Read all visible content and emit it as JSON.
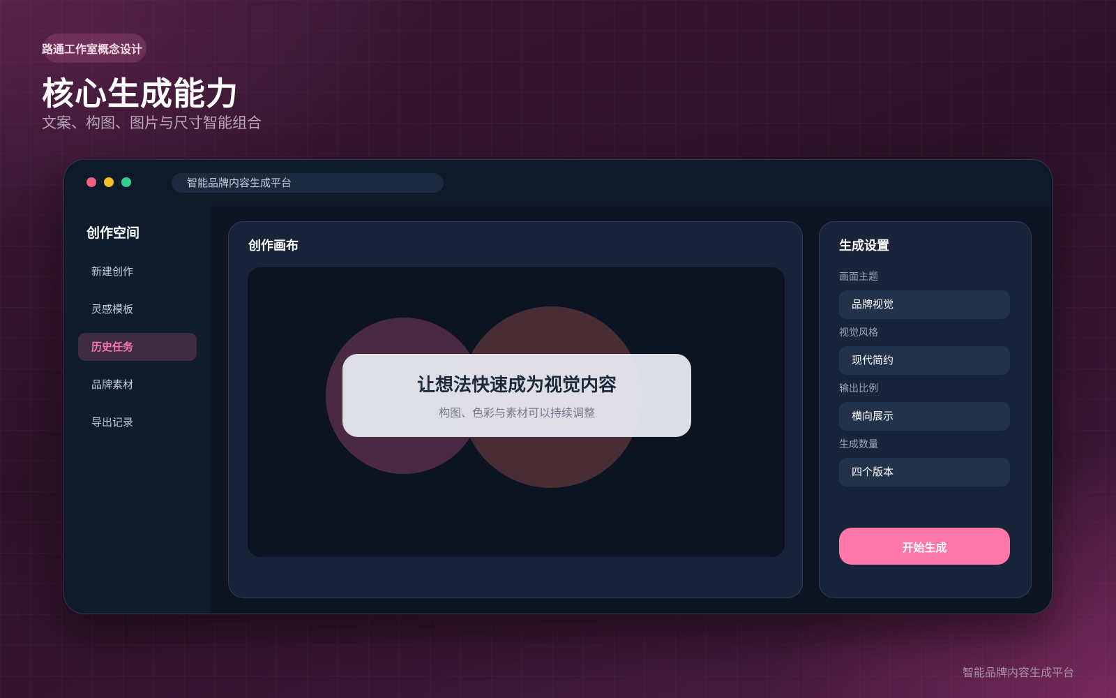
{
  "header": {
    "kicker": "路通工作室概念设计",
    "title": "核心生成能力",
    "subtitle": "文案、构图、图片与尺寸智能组合"
  },
  "window": {
    "url_title": "智能品牌内容生成平台",
    "traffic_lights": [
      "#f2607e",
      "#f4bd2a",
      "#33cf8c"
    ]
  },
  "sidebar": {
    "title": "创作空间",
    "items": [
      {
        "label": "新建创作",
        "active": false
      },
      {
        "label": "灵感模板",
        "active": false
      },
      {
        "label": "历史任务",
        "active": true
      },
      {
        "label": "品牌素材",
        "active": false
      },
      {
        "label": "导出记录",
        "active": false
      }
    ]
  },
  "canvas": {
    "title": "创作画布",
    "card_title": "让想法快速成为视觉内容",
    "card_subtitle": "构图、色彩与素材可以持续调整"
  },
  "settings": {
    "title": "生成设置",
    "fields": [
      {
        "label": "画面主题",
        "value": "品牌视觉"
      },
      {
        "label": "视觉风格",
        "value": "现代简约"
      },
      {
        "label": "输出比例",
        "value": "横向展示"
      },
      {
        "label": "生成数量",
        "value": "四个版本"
      }
    ],
    "generate_label": "开始生成"
  },
  "footer": {
    "text": "智能品牌内容生成平台"
  },
  "colors": {
    "accent": "#ff77a9",
    "active_nav_bg": "#3e2c43",
    "panel_bg": "#17243a"
  }
}
